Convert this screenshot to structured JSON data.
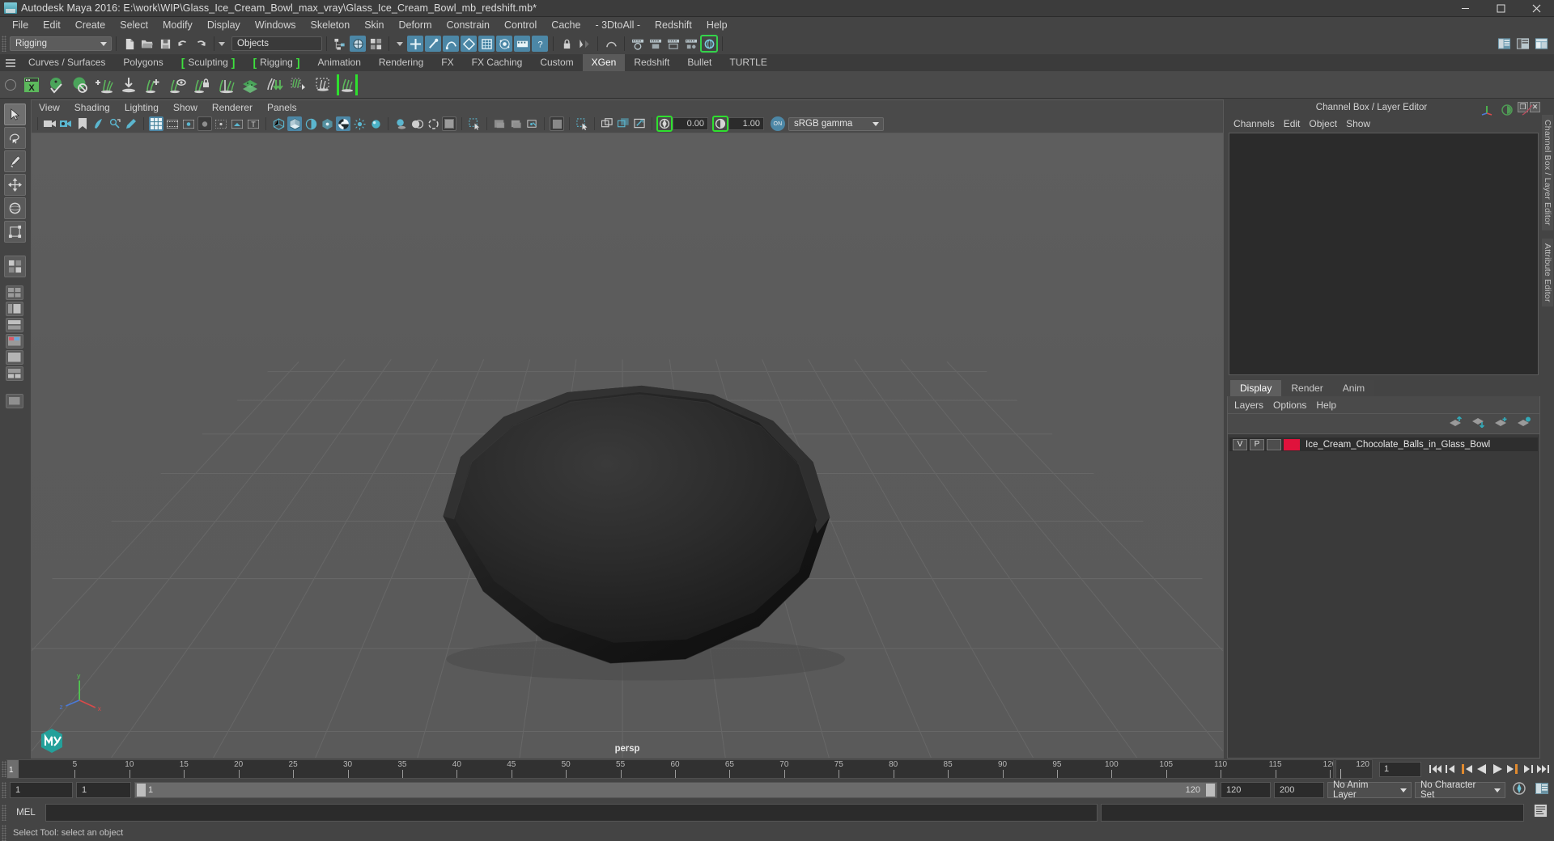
{
  "titlebar": {
    "app_icon": "maya-app-icon",
    "title": "Autodesk Maya 2016: E:\\work\\WIP\\Glass_Ice_Cream_Bowl_max_vray\\Glass_Ice_Cream_Bowl_mb_redshift.mb*",
    "minimize_label": "–",
    "maximize_label": "❐",
    "close_label": "✕"
  },
  "menubar": {
    "items": [
      "File",
      "Edit",
      "Create",
      "Select",
      "Modify",
      "Display",
      "Windows",
      "Skeleton",
      "Skin",
      "Deform",
      "Constrain",
      "Control",
      "Cache",
      "- 3DtoAll -",
      "Redshift",
      "Help"
    ]
  },
  "statusline": {
    "menu_set": "Rigging",
    "selection_mask": "Objects",
    "icons": [
      "new-scene-icon",
      "open-scene-icon",
      "save-scene-icon",
      "undo-icon",
      "redo-icon",
      "select-by-hierarchy-icon",
      "select-by-object-icon",
      "select-by-component-icon",
      "handles-icon",
      "joints-icon",
      "curves-icon",
      "surfaces-icon",
      "deformations-icon",
      "dynamics-icon",
      "rendering-icon",
      "misc-icon",
      "lock-icon",
      "snap-to-grid-icon",
      "construction-history-icon",
      "render-current-frame-icon",
      "ipr-icon",
      "render-settings-icon",
      "hypershade-icon",
      "show-editor-icon",
      "open-attribute-editor-icon",
      "open-tool-settings-icon",
      "open-channel-box-icon"
    ]
  },
  "shelf": {
    "tabs": [
      {
        "label": "Curves / Surfaces",
        "active": false,
        "bracket": false
      },
      {
        "label": "Polygons",
        "active": false,
        "bracket": false
      },
      {
        "label": "Sculpting",
        "active": false,
        "bracket": true
      },
      {
        "label": "Rigging",
        "active": false,
        "bracket": true
      },
      {
        "label": "Animation",
        "active": false,
        "bracket": false
      },
      {
        "label": "Rendering",
        "active": false,
        "bracket": false
      },
      {
        "label": "FX",
        "active": false,
        "bracket": false
      },
      {
        "label": "FX Caching",
        "active": false,
        "bracket": false
      },
      {
        "label": "Custom",
        "active": false,
        "bracket": false
      },
      {
        "label": "XGen",
        "active": true,
        "bracket": false
      },
      {
        "label": "Redshift",
        "active": false,
        "bracket": false
      },
      {
        "label": "Bullet",
        "active": false,
        "bracket": false
      },
      {
        "label": "TURTLE",
        "active": false,
        "bracket": false
      }
    ],
    "icons": [
      "xgen-editor-icon",
      "xgen-preview-icon",
      "xgen-render-icon",
      "xgen-add-description-icon",
      "xgen-import-collection-icon",
      "xgen-groom-add-icon",
      "xgen-groom-visibility-icon",
      "xgen-groom-lock-icon",
      "xgen-groom-comb-icon",
      "xgen-scatter-icon",
      "xgen-clump-icon",
      "xgen-density-icon",
      "xgen-region-icon",
      "xgen-guides-icon"
    ]
  },
  "toolbox": {
    "items": [
      "select-tool",
      "lasso-select-tool",
      "paint-select-tool",
      "move-tool",
      "rotate-tool",
      "scale-tool",
      "last-tool",
      "four-view-layout",
      "persp-outliner-layout",
      "persp-graph-layout",
      "hypershade-persp-layout",
      "persp-layout",
      "outliner-persp-layout",
      "single-perspective-view"
    ]
  },
  "viewport": {
    "menus": [
      "View",
      "Shading",
      "Lighting",
      "Show",
      "Renderer",
      "Panels"
    ],
    "toolbar_icons": [
      "select-camera-icon",
      "camera-attributes-icon",
      "bookmarks-icon",
      "image-plane-icon",
      "two-d-pan-zoom-icon",
      "grease-pencil-icon",
      "grid-toggle-icon",
      "film-gate-icon",
      "resolution-gate-icon",
      "gate-mask-icon",
      "film-origin-icon",
      "safe-action-icon",
      "safe-title-icon",
      "wireframe-icon",
      "smooth-shade-all-icon",
      "smooth-shade-selected-icon",
      "flat-shade-icon",
      "wireframe-on-shaded-icon",
      "lights-icon",
      "default-light-icon",
      "shadows-icon",
      "screen-space-ao-icon",
      "motion-blur-icon",
      "multisample-icon",
      "isolate-select-icon"
    ],
    "exposure_label": "exposure-icon",
    "exposure_value": "0.00",
    "gamma_label": "gamma-icon",
    "gamma_value": "1.00",
    "color_management_toggle": "ON",
    "color_profile": "sRGB gamma",
    "camera_label": "persp",
    "axis_labels": {
      "x": "x",
      "y": "y",
      "z": "z"
    }
  },
  "right_panel": {
    "title": "Channel Box / Layer Editor",
    "restore_label": "❐",
    "close_label": "✕",
    "channelbox_menus": [
      "Channels",
      "Edit",
      "Object",
      "Show"
    ],
    "header_icons": [
      "axis-gizmo-icon",
      "anim-layer-icon",
      "motion-trail-icon"
    ],
    "layer_tabs": [
      {
        "label": "Display",
        "active": true
      },
      {
        "label": "Render",
        "active": false
      },
      {
        "label": "Anim",
        "active": false
      }
    ],
    "layer_menus": [
      "Layers",
      "Options",
      "Help"
    ],
    "layer_buttons": [
      "move-layer-up-icon",
      "move-layer-down-icon",
      "new-layer-icon",
      "new-layer-from-selected-icon"
    ],
    "layers": [
      {
        "visibility": "V",
        "playback": "P",
        "type": "",
        "color": "#e0123c",
        "name": "Ice_Cream_Chocolate_Balls_in_Glass_Bowl"
      }
    ]
  },
  "vertical_tabs": [
    "Channel Box / Layer Editor",
    "Attribute Editor"
  ],
  "timeline": {
    "current_frame_marker": "1",
    "ticks": [
      5,
      10,
      15,
      20,
      25,
      30,
      35,
      40,
      45,
      50,
      55,
      60,
      65,
      70,
      75,
      80,
      85,
      90,
      95,
      100,
      105,
      110,
      115,
      120
    ],
    "range_end_label": "120",
    "current_frame_field": "1",
    "playback_buttons": [
      "go-to-start-icon",
      "step-back-keyframe-icon",
      "step-back-frame-icon",
      "play-backwards-icon",
      "play-forwards-icon",
      "step-forward-frame-icon",
      "step-forward-keyframe-icon",
      "go-to-end-icon"
    ]
  },
  "range_bar": {
    "anim_start": "1",
    "range_start": "1",
    "slider_start_label": "1",
    "slider_end_label": "120",
    "range_end": "120",
    "anim_end": "200",
    "anim_layer": "No Anim Layer",
    "character_set": "No Character Set",
    "auto_key_icon": "auto-keyframe-icon",
    "anim_prefs_icon": "animation-preferences-icon"
  },
  "command_line": {
    "language_label": "MEL",
    "input_value": "",
    "script_editor_icon": "script-editor-icon"
  },
  "status_bar": {
    "help_text": "Select Tool: select an object"
  }
}
